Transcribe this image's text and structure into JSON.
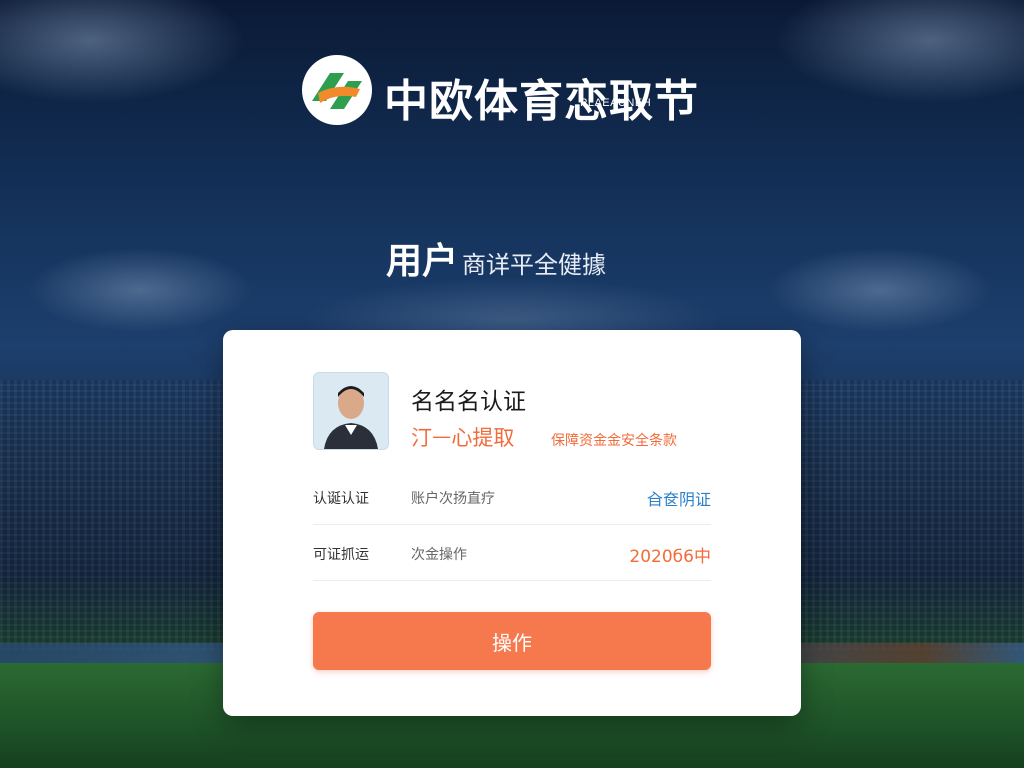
{
  "colors": {
    "accent": "#f5794c",
    "link": "#2a7fc8",
    "warning_text": "#f26b3a",
    "logo_green": "#2e9e4f",
    "logo_orange": "#f08a2a"
  },
  "header": {
    "logo_icon": "brand-logo-icon",
    "title": "中欧体育恋取节",
    "subtitle": "PLAEAUNEH"
  },
  "page": {
    "subtitle_strong": "用户",
    "subtitle_light": "商详平全健據"
  },
  "card": {
    "avatar_icon": "user-photo",
    "name": "名名名认证",
    "withdraw_label": "汀ᅳ心提取",
    "guarantee_text": "保障资金金安全条款",
    "rows": [
      {
        "key": "认诞认证",
        "middle": "账户次扬直疗",
        "value": "㒲奁阴证"
      },
      {
        "key": "可证抓运",
        "middle": "次金操作",
        "value": "2020б6中"
      }
    ],
    "action_button": "操作"
  }
}
